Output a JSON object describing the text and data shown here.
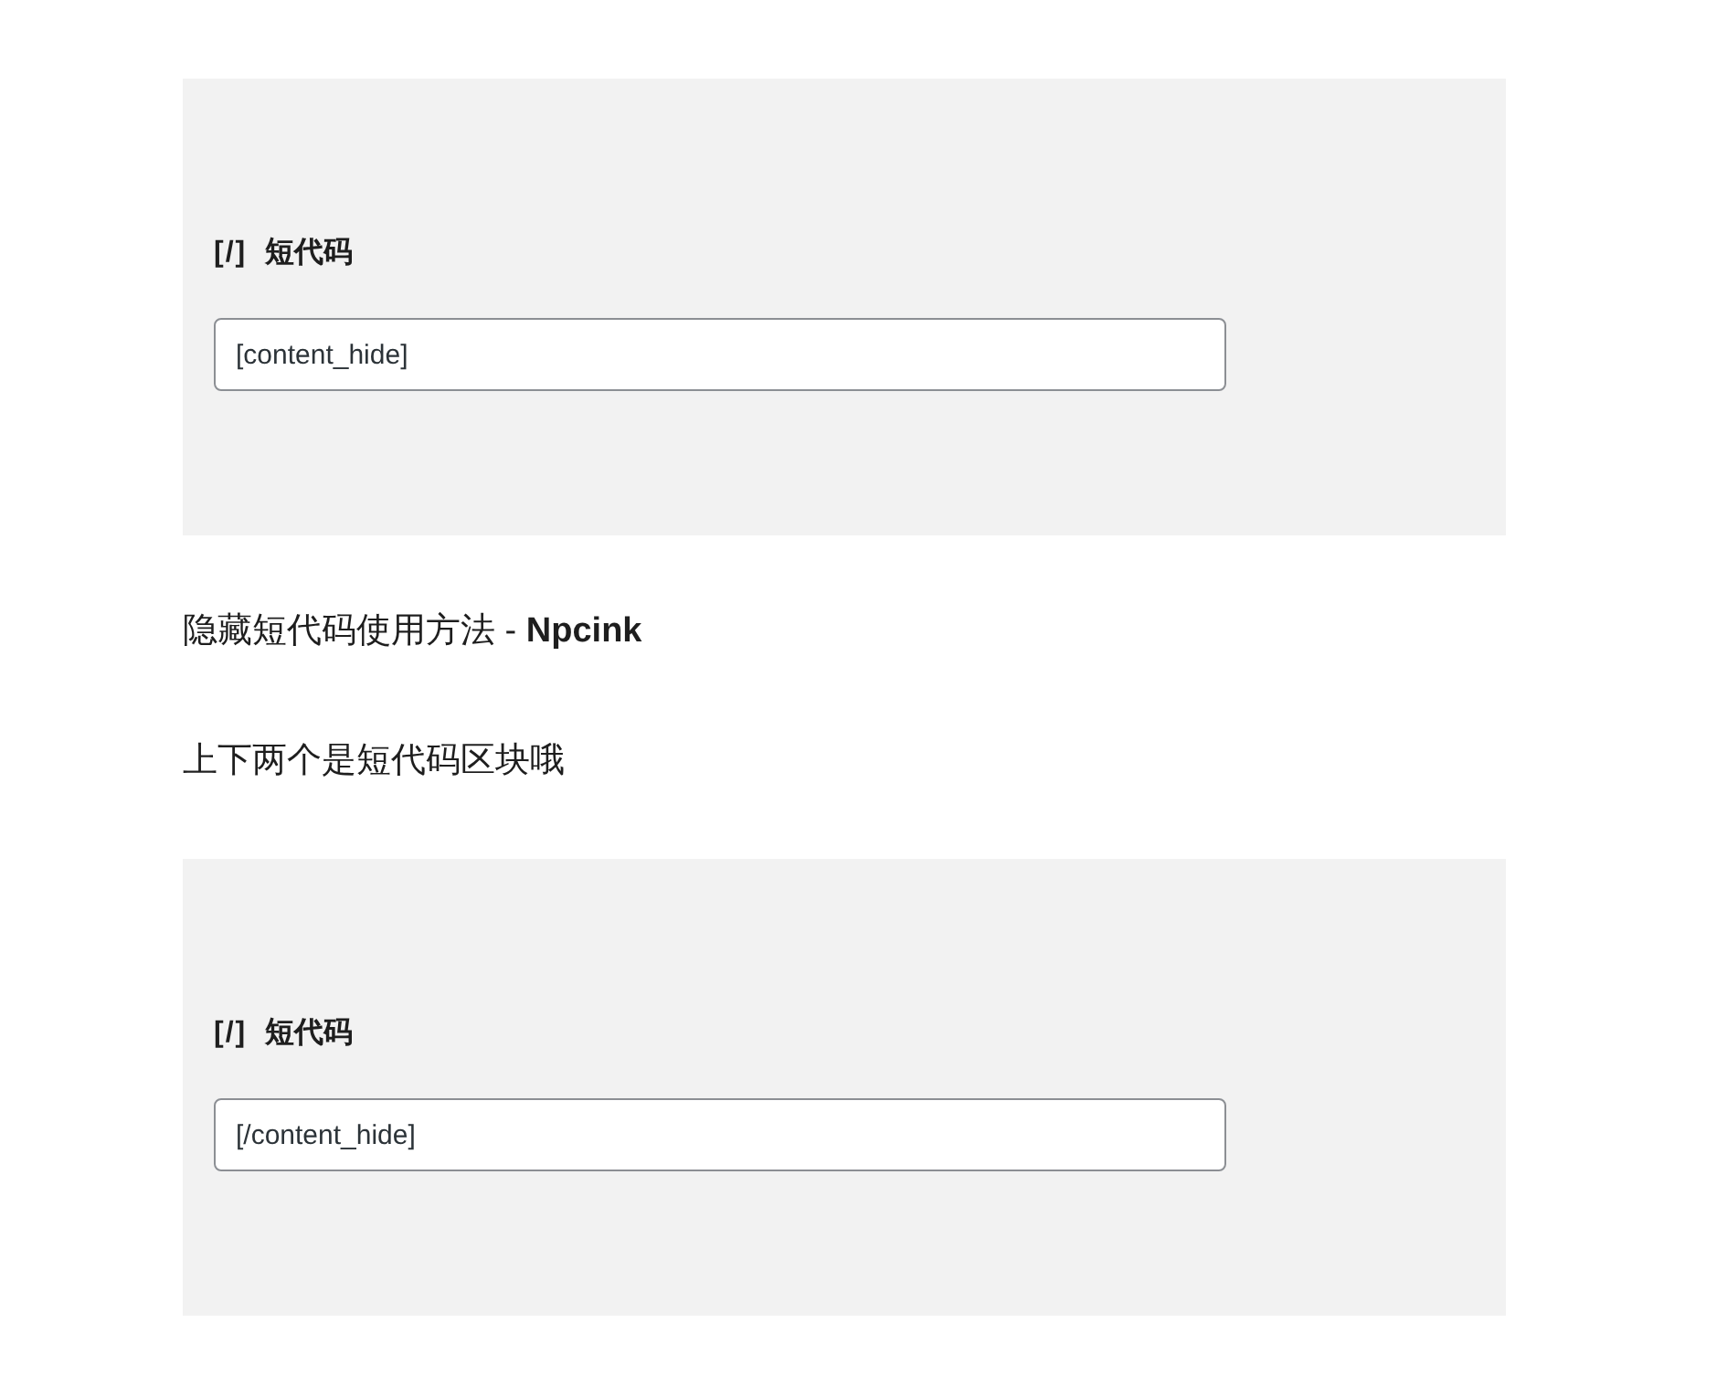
{
  "content": [
    {
      "kind": "shortcode",
      "icon": "[/]",
      "label": "短代码",
      "value": "[content_hide]"
    },
    {
      "kind": "paragraph",
      "text": "隐藏短代码使用方法 - **Npcink**"
    },
    {
      "kind": "paragraph",
      "text": "上下两个是短代码区块哦"
    },
    {
      "kind": "shortcode",
      "icon": "[/]",
      "label": "短代码",
      "value": "[/content_hide]"
    }
  ]
}
